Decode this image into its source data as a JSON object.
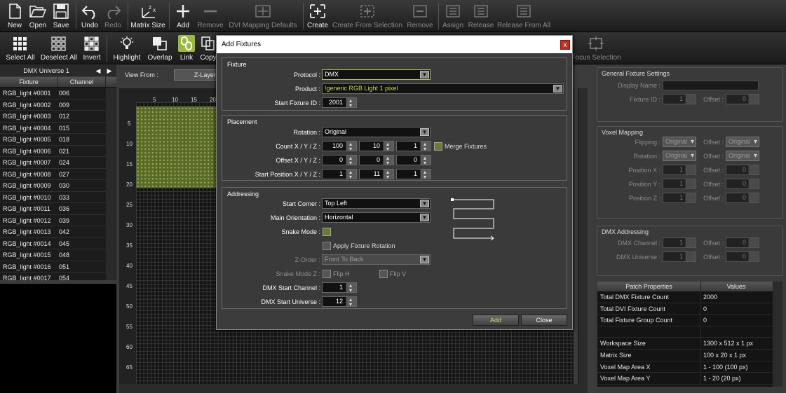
{
  "toolbar1": {
    "buttons": [
      {
        "label": "New",
        "icon": "new-file-icon"
      },
      {
        "label": "Open",
        "icon": "folder-open-icon"
      },
      {
        "label": "Save",
        "icon": "save-disk-icon"
      },
      {
        "label": "Undo",
        "icon": "undo-icon"
      },
      {
        "label": "Redo",
        "icon": "redo-icon"
      },
      {
        "label": "Matrix Size",
        "icon": "matrix-size-icon"
      },
      {
        "label": "Add",
        "icon": "plus-icon"
      },
      {
        "label": "Remove",
        "icon": "minus-icon"
      },
      {
        "label": "DVI Mapping Defaults",
        "icon": "dvi-mapping-icon"
      },
      {
        "label": "Create",
        "icon": "create-group-icon"
      },
      {
        "label": "Create From Selection",
        "icon": "create-from-selection-icon"
      },
      {
        "label": "Remove",
        "icon": "remove-group-icon"
      },
      {
        "label": "Assign",
        "icon": "assign-icon"
      },
      {
        "label": "Release",
        "icon": "release-icon"
      },
      {
        "label": "Release From All",
        "icon": "release-from-all-icon"
      }
    ]
  },
  "toolbar2": {
    "buttons": [
      {
        "label": "Select All",
        "icon": "select-all-icon"
      },
      {
        "label": "Deselect All",
        "icon": "deselect-all-icon"
      },
      {
        "label": "Invert",
        "icon": "invert-icon"
      },
      {
        "label": "Highlight",
        "icon": "highlight-bulb-icon"
      },
      {
        "label": "Overlap",
        "icon": "overlap-icon"
      },
      {
        "label": "Link",
        "icon": "link-icon"
      },
      {
        "label": "Copy",
        "icon": "copy-icon"
      },
      {
        "label": "Focus Selection",
        "icon": "focus-selection-icon"
      }
    ]
  },
  "left_panel": {
    "universe_title": "DMX Universe 1",
    "columns": [
      "Fixture",
      "Channel"
    ],
    "rows": [
      [
        "RGB_light #0001",
        "006"
      ],
      [
        "RGB_light #0002",
        "009"
      ],
      [
        "RGB_light #0003",
        "012"
      ],
      [
        "RGB_light #0004",
        "015"
      ],
      [
        "RGB_light #0005",
        "018"
      ],
      [
        "RGB_light #0006",
        "021"
      ],
      [
        "RGB_light #0007",
        "024"
      ],
      [
        "RGB_light #0008",
        "027"
      ],
      [
        "RGB_light #0009",
        "030"
      ],
      [
        "RGB_light #0010",
        "033"
      ],
      [
        "RGB_light #0011",
        "036"
      ],
      [
        "RGB_light #0012",
        "039"
      ],
      [
        "RGB_light #0013",
        "042"
      ],
      [
        "RGB_light #0014",
        "045"
      ],
      [
        "RGB_light #0015",
        "048"
      ],
      [
        "RGB_light #0016",
        "051"
      ],
      [
        "RGB_light #0017",
        "054"
      ]
    ]
  },
  "center": {
    "view_from_label": "View From :",
    "view_from_value": "Z-Layer",
    "x_ticks": [
      "5",
      "10",
      "15",
      "20"
    ],
    "y_ticks": [
      "5",
      "10",
      "15",
      "20",
      "25",
      "30",
      "35",
      "40",
      "45",
      "50",
      "55",
      "60",
      "65"
    ]
  },
  "dialog": {
    "title": "Add Fixtures",
    "close_glyph": "x",
    "fixture_group": "Fixture",
    "protocol_label": "Protocol :",
    "protocol_value": "DMX",
    "product_label": "Product :",
    "product_value": "!generic RGB Light 1 pixel",
    "start_fixture_id_label": "Start Fixture ID :",
    "start_fixture_id_value": "2001",
    "placement_group": "Placement",
    "rotation_label": "Rotation :",
    "rotation_value": "Original",
    "count_label": "Count X / Y / Z :",
    "count_values": [
      "100",
      "10",
      "1"
    ],
    "merge_fixtures_label": "Merge Fixtures",
    "offset_label": "Offset X / Y / Z :",
    "offset_values": [
      "0",
      "0",
      "0"
    ],
    "start_pos_label": "Start Position X / Y / Z :",
    "start_pos_values": [
      "1",
      "11",
      "1"
    ],
    "addressing_group": "Addressing",
    "start_corner_label": "Start Corner :",
    "start_corner_value": "Top Left",
    "main_orientation_label": "Main Orientation :",
    "main_orientation_value": "Horizontal",
    "snake_mode_label": "Snake Mode :",
    "apply_rotation_label": "Apply Fixture Rotation",
    "z_order_label": "Z-Order :",
    "z_order_value": "Front To Back",
    "snake_mode_z_label": "Snake Mode Z :",
    "flip_h_label": "Flip H",
    "flip_v_label": "Flip V",
    "dmx_start_channel_label": "DMX Start Channel :",
    "dmx_start_channel_value": "1",
    "dmx_start_universe_label": "DMX Start Universe :",
    "dmx_start_universe_value": "12",
    "add_button": "Add",
    "close_button": "Close"
  },
  "right_panel": {
    "general_group": "General Fixture Settings",
    "display_name_label": "Display Name :",
    "fixture_id_label": "Fixture ID :",
    "fixture_id_value": "1",
    "offset_label": "Offset :",
    "offset_value": "0",
    "voxel_group": "Voxel Mapping",
    "flipping_label": "Flipping :",
    "rotation_label": "Rotation :",
    "original_value": "Original",
    "position_x_label": "Position X :",
    "position_y_label": "Position Y :",
    "position_z_label": "Position Z :",
    "pos_value": "1",
    "dmx_group": "DMX Addressing",
    "dmx_channel_label": "DMX Channel :",
    "dmx_universe_label": "DMX Universe :",
    "patch_columns": [
      "Patch Properties",
      "Values"
    ],
    "patch_rows": [
      [
        "Total DMX Fixture Count",
        "2000"
      ],
      [
        "Total DVI Fixture Count",
        "0"
      ],
      [
        "Total Fixture Group Count",
        "0"
      ],
      [
        "",
        ""
      ],
      [
        "Workspace Size",
        "1300 x 512 x 1 px"
      ],
      [
        "Matrix Size",
        "100 x 20 x 1 px"
      ],
      [
        "Voxel Map Area X",
        "1 - 100 (100 px)"
      ],
      [
        "Voxel Map Area Y",
        "1 - 20 (20 px)"
      ]
    ]
  },
  "colors": {
    "accent_green": "#9aba3c",
    "fixture_fill": "#5a6a2a",
    "close_red": "#c42b1c"
  }
}
